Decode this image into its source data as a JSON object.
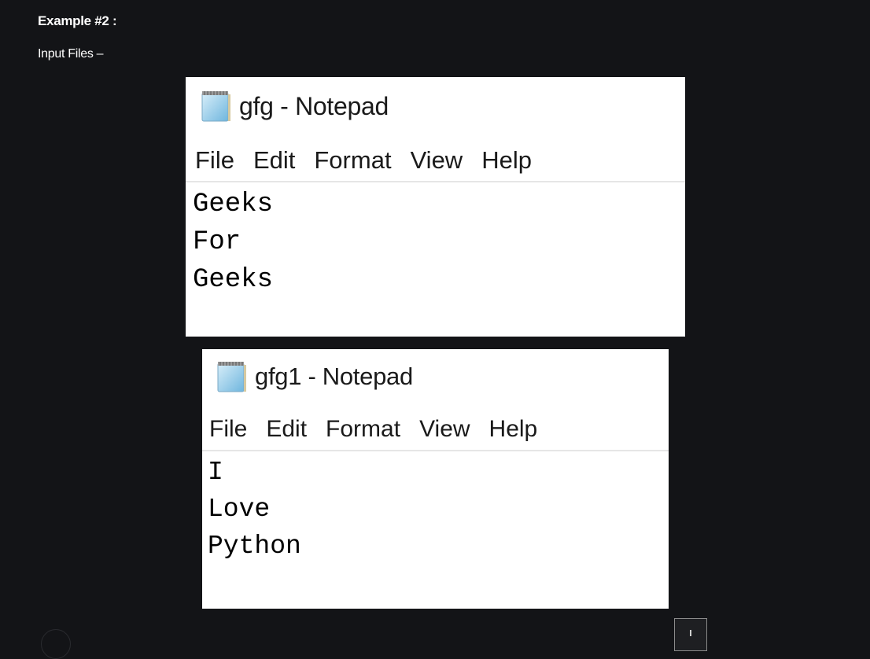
{
  "article": {
    "heading": "Example #2 :",
    "subheading": "Input Files –"
  },
  "notepads": [
    {
      "title": "gfg - Notepad",
      "icon": "notepad-icon",
      "menu": [
        "File",
        "Edit",
        "Format",
        "View",
        "Help"
      ],
      "lines": [
        "Geeks",
        "For",
        "Geeks"
      ]
    },
    {
      "title": "gfg1 - Notepad",
      "icon": "notepad-icon",
      "menu": [
        "File",
        "Edit",
        "Format",
        "View",
        "Help"
      ],
      "lines": [
        "I",
        "Love",
        "Python"
      ]
    }
  ],
  "controls": {
    "scroll_top_icon": "arrow-up-icon"
  }
}
